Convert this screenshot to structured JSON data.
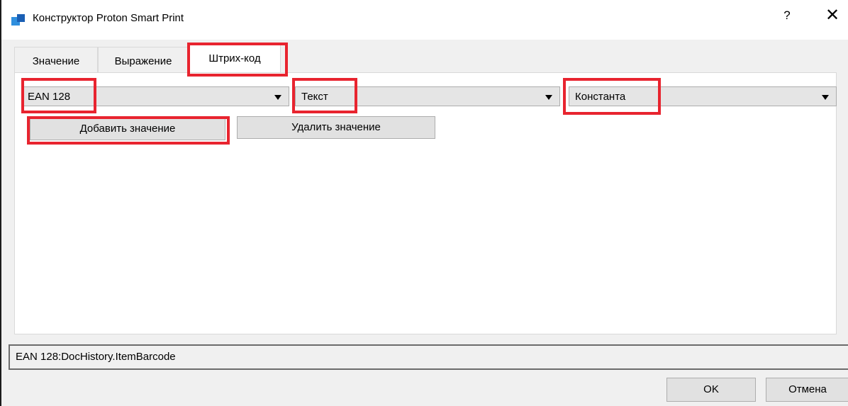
{
  "window": {
    "title": "Конструктор Proton Smart Print",
    "help_label": "?",
    "close_label": "✕"
  },
  "tabs": [
    {
      "label": "Значение",
      "active": false
    },
    {
      "label": "Выражение",
      "active": false
    },
    {
      "label": "Штрих-код",
      "active": true
    }
  ],
  "barcode_tab": {
    "barcode_type": {
      "value": "EAN 128"
    },
    "source_type": {
      "value": "Текст"
    },
    "value_kind": {
      "value": "Константа"
    },
    "add_value_button": "Добавить значение",
    "remove_value_button": "Удалить значение"
  },
  "result_text": "EAN 128:DocHistory.ItemBarcode",
  "footer": {
    "ok_label": "OK",
    "cancel_label": "Отмена"
  },
  "colors": {
    "highlight": "#e8242f",
    "icon_light": "#2f8fde",
    "icon_dark": "#1a5fb4"
  }
}
